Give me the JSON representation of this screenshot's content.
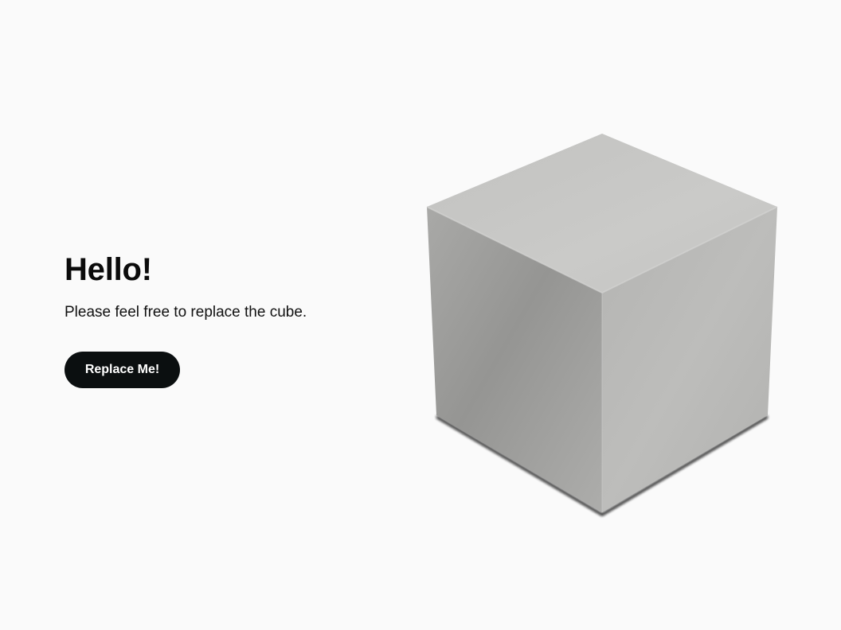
{
  "hero": {
    "title": "Hello!",
    "subtitle": "Please feel free to replace the cube.",
    "button_label": "Replace Me!"
  },
  "colors": {
    "background": "#fafafa",
    "text": "#0b0b0b",
    "button_bg": "#0b0f10",
    "button_text": "#ffffff",
    "cube_top": "#c7c7c5",
    "cube_left": "#9c9c9a",
    "cube_right": "#b8b8b6"
  },
  "icons": {
    "cube": "cube-icon"
  }
}
